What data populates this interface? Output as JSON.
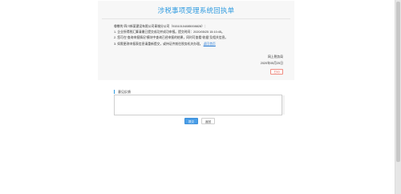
{
  "receipt": {
    "title": "涉税事项受理系统回执单",
    "lines": [
      "尊敬的 四川新厦建设有限公司青城分公司（91510104085008828）：",
      "1. 企业所得税汇算清缴已提交成功并成功申报。提交时间：2020/05/25 15:10:45。",
      "2. 您可在“查询申报情况”模块中查询已经申报的结果，同时可查看“收据”及相关信息。",
      "3. 如需更改申报表信息请重新提交，或持证件前往税务机关办理。"
    ],
    "link_label": "返回首页",
    "issuer": "网上税务局",
    "date": "2020年05月25日",
    "print_label": "打印"
  },
  "feedback": {
    "label": "意见反馈",
    "placeholder": "",
    "value": ""
  },
  "buttons": {
    "submit_label": "提交",
    "return_label": "返回"
  },
  "colors": {
    "accent": "#2f9be0",
    "print_border": "#f08c82",
    "submit_bg": "#4a9ee8"
  }
}
